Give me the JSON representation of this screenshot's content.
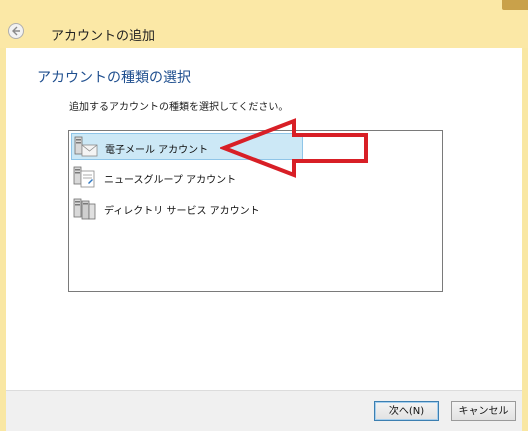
{
  "window": {
    "title": "アカウントの追加"
  },
  "page": {
    "heading": "アカウントの種類の選択",
    "instruction": "追加するアカウントの種類を選択してください。"
  },
  "account_types": [
    {
      "label": "電子メール アカウント",
      "icon": "email-account-icon",
      "selected": true
    },
    {
      "label": "ニュースグループ アカウント",
      "icon": "newsgroup-account-icon",
      "selected": false
    },
    {
      "label": "ディレクトリ サービス アカウント",
      "icon": "directory-service-icon",
      "selected": false
    }
  ],
  "buttons": {
    "next": "次へ(N)",
    "cancel": "キャンセル"
  },
  "colors": {
    "title_background": "#fbe8a6",
    "heading_blue": "#1f4f8f",
    "selection": "#cce8f6",
    "annotation_arrow": "#d81f26"
  }
}
